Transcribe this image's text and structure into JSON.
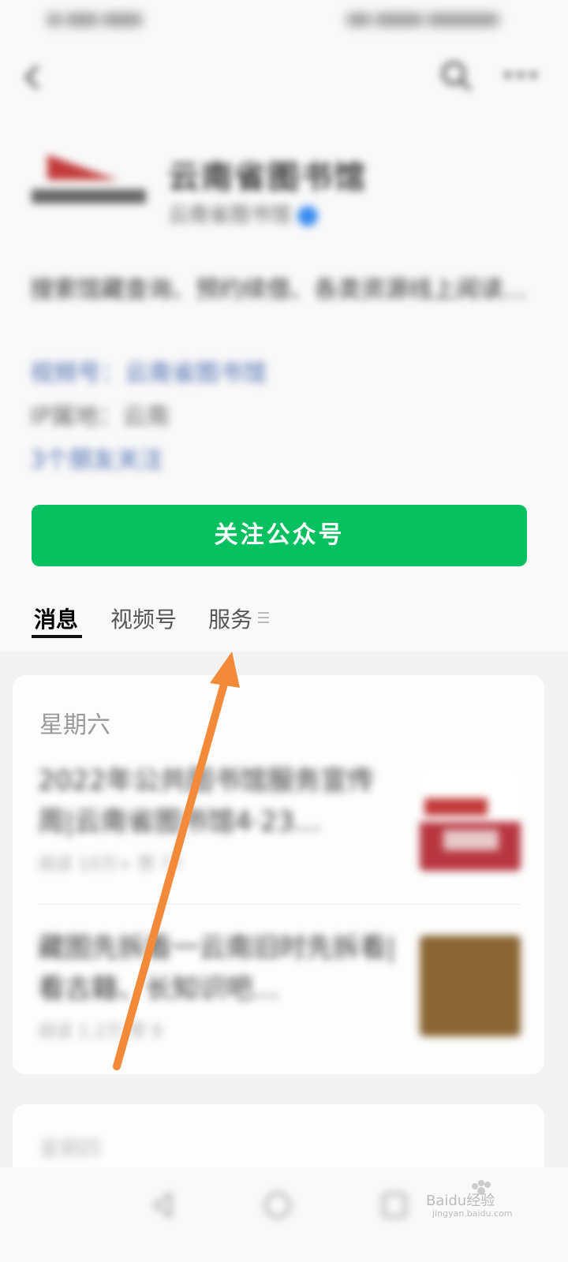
{
  "status_bar": {
    "left_text": "",
    "right_text": ""
  },
  "profile": {
    "name": "云南省图书馆",
    "account": "云南省图书馆",
    "description": "搜索馆藏查询、预约续借、各类资源线上阅读…",
    "video_channel": "视频号：云南省图书馆",
    "ip_location": "IP属地：云南",
    "friends_following": "3个朋友关注"
  },
  "follow_button": {
    "label": "关注公众号"
  },
  "tabs": [
    {
      "label": "消息"
    },
    {
      "label": "视频号"
    },
    {
      "label": "服务"
    }
  ],
  "feed": {
    "date": "星期六",
    "articles": [
      {
        "title": "2022年公共图书馆服务宣传周|云南省图书馆4·23…",
        "meta": "阅读 10万+  赞 77"
      },
      {
        "title": "藏图先拆看一云南旧时先拆看|看古籍、长知识吧…",
        "meta": "阅读 1.2万  赞 9"
      }
    ],
    "next_date": "星期四"
  },
  "watermark": {
    "text": "Baidu经验",
    "sub": "jingyan.baidu.com"
  },
  "colors": {
    "accent": "#07c160",
    "link": "#4a6bb0",
    "arrow": "#f38a3a"
  }
}
